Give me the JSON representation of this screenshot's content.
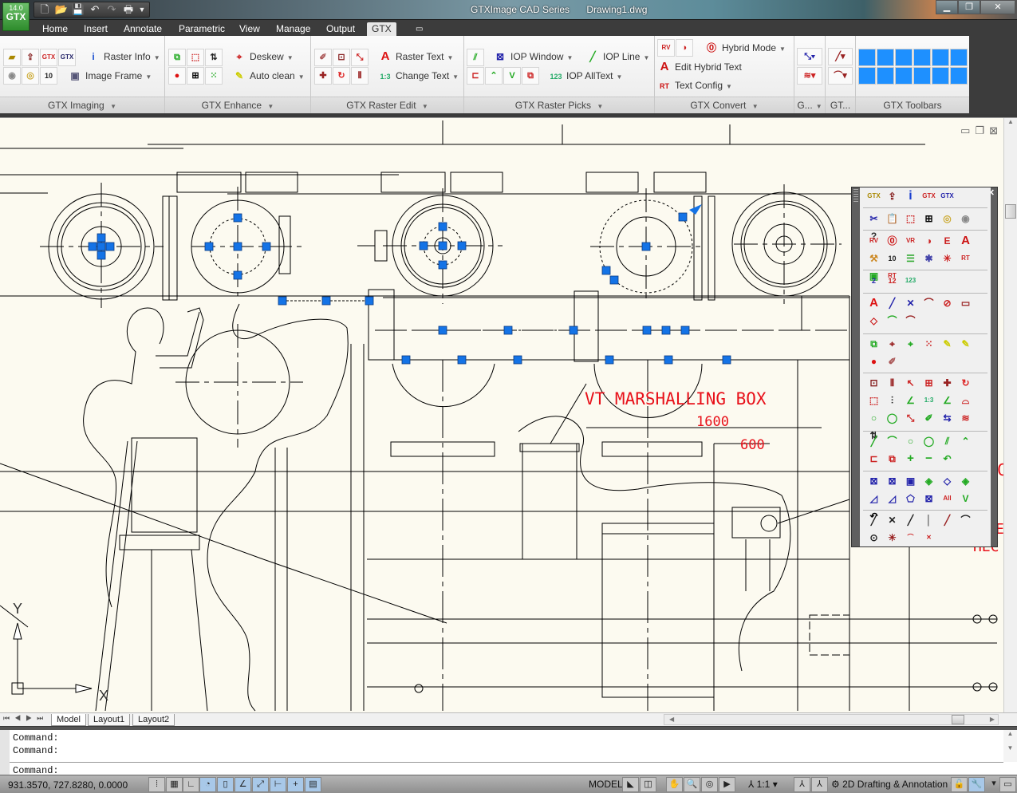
{
  "app": {
    "logo_version": "14.0",
    "logo_text": "GTX",
    "title": "GTXImage CAD Series",
    "document": "Drawing1.dwg",
    "window_buttons": [
      "minimize-icon",
      "restore-icon",
      "close-icon"
    ]
  },
  "quick_access": [
    "new-icon",
    "open-icon",
    "save-icon",
    "undo-icon",
    "redo-icon",
    "plot-icon",
    "customize-dropdown-icon"
  ],
  "menu_tabs": [
    {
      "label": "Home"
    },
    {
      "label": "Insert"
    },
    {
      "label": "Annotate"
    },
    {
      "label": "Parametric"
    },
    {
      "label": "View"
    },
    {
      "label": "Manage"
    },
    {
      "label": "Output"
    },
    {
      "label": "GTX",
      "active": true
    }
  ],
  "ribbon": {
    "panels": [
      {
        "title": "GTX Imaging",
        "buttons": [
          {
            "label": "Raster Info"
          },
          {
            "label": "Image Frame"
          }
        ]
      },
      {
        "title": "GTX Enhance",
        "buttons": [
          {
            "label": "Deskew"
          },
          {
            "label": "Auto clean"
          }
        ]
      },
      {
        "title": "GTX Raster Edit",
        "buttons": [
          {
            "label": "Raster Text"
          },
          {
            "label": "Change Text"
          }
        ]
      },
      {
        "title": "GTX Raster Picks",
        "buttons": [
          {
            "label": "IOP Window"
          },
          {
            "label": "IOP Line"
          },
          {
            "label": "IOP AllText"
          }
        ]
      },
      {
        "title": "GTX Convert",
        "buttons": [
          {
            "label": "Hybrid Mode"
          },
          {
            "label": "Edit Hybrid Text"
          },
          {
            "label": "Text Config"
          }
        ]
      },
      {
        "title": "G..."
      },
      {
        "title": "GT..."
      },
      {
        "title": "GTX Toolbars"
      }
    ]
  },
  "drawing": {
    "annotations": [
      {
        "text": "VT MARSHALLING BOX",
        "color": "#e8111a"
      },
      {
        "text": "1600",
        "color": "#e8111a"
      },
      {
        "text": "600",
        "color": "#e8111a"
      }
    ],
    "ucs": {
      "x_label": "X",
      "y_label": "Y"
    },
    "grip_color": "#1473e6"
  },
  "layout_tabs": [
    {
      "label": "Model",
      "active": true
    },
    {
      "label": "Layout1"
    },
    {
      "label": "Layout2"
    }
  ],
  "command": {
    "history": [
      "Command:",
      "Command:"
    ],
    "prompt": "Command:"
  },
  "status": {
    "coordinates": "931.3570, 727.8280, 0.0000",
    "space": "MODEL",
    "annotation_scale": "1:1",
    "workspace": "2D Drafting & Annotation"
  }
}
